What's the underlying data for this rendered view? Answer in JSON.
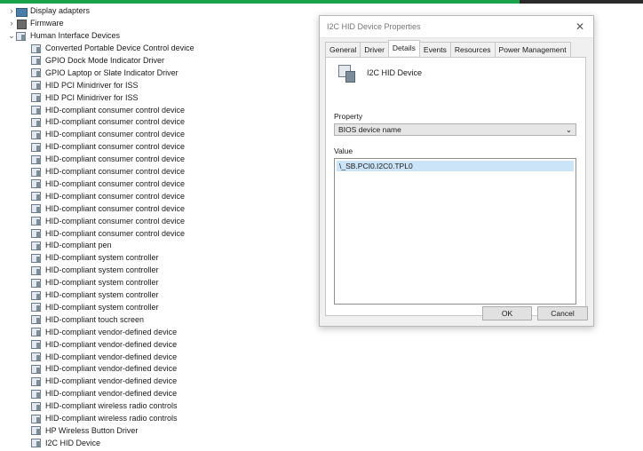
{
  "tree": {
    "categories": [
      {
        "label": "Display adapters",
        "state": "collapsed",
        "icon": "display-adapter-icon"
      },
      {
        "label": "Firmware",
        "state": "collapsed",
        "icon": "firmware-icon"
      },
      {
        "label": "Human Interface Devices",
        "state": "expanded",
        "icon": "hid-category-icon"
      }
    ],
    "hid_devices": [
      "Converted Portable Device Control device",
      "GPIO Dock Mode Indicator Driver",
      "GPIO Laptop or Slate Indicator Driver",
      "HID PCI Minidriver for ISS",
      "HID PCI Minidriver for ISS",
      "HID-compliant consumer control device",
      "HID-compliant consumer control device",
      "HID-compliant consumer control device",
      "HID-compliant consumer control device",
      "HID-compliant consumer control device",
      "HID-compliant consumer control device",
      "HID-compliant consumer control device",
      "HID-compliant consumer control device",
      "HID-compliant consumer control device",
      "HID-compliant consumer control device",
      "HID-compliant consumer control device",
      "HID-compliant pen",
      "HID-compliant system controller",
      "HID-compliant system controller",
      "HID-compliant system controller",
      "HID-compliant system controller",
      "HID-compliant system controller",
      "HID-compliant touch screen",
      "HID-compliant vendor-defined device",
      "HID-compliant vendor-defined device",
      "HID-compliant vendor-defined device",
      "HID-compliant vendor-defined device",
      "HID-compliant vendor-defined device",
      "HID-compliant vendor-defined device",
      "HID-compliant wireless radio controls",
      "HID-compliant wireless radio controls",
      "HP Wireless Button Driver",
      "I2C HID Device"
    ]
  },
  "dialog": {
    "title": "I2C HID Device Properties",
    "close_icon": "close-icon",
    "tabs": [
      "General",
      "Driver",
      "Details",
      "Events",
      "Resources",
      "Power Management"
    ],
    "active_tab": "Details",
    "device_name": "I2C HID Device",
    "property_label": "Property",
    "property_value": "BIOS device name",
    "value_label": "Value",
    "values": [
      "\\_SB.PCI0.I2C0.TPL0"
    ],
    "ok_label": "OK",
    "cancel_label": "Cancel"
  },
  "colors": {
    "accent_bar": "#1aa34a",
    "selection": "#cce4f7"
  }
}
